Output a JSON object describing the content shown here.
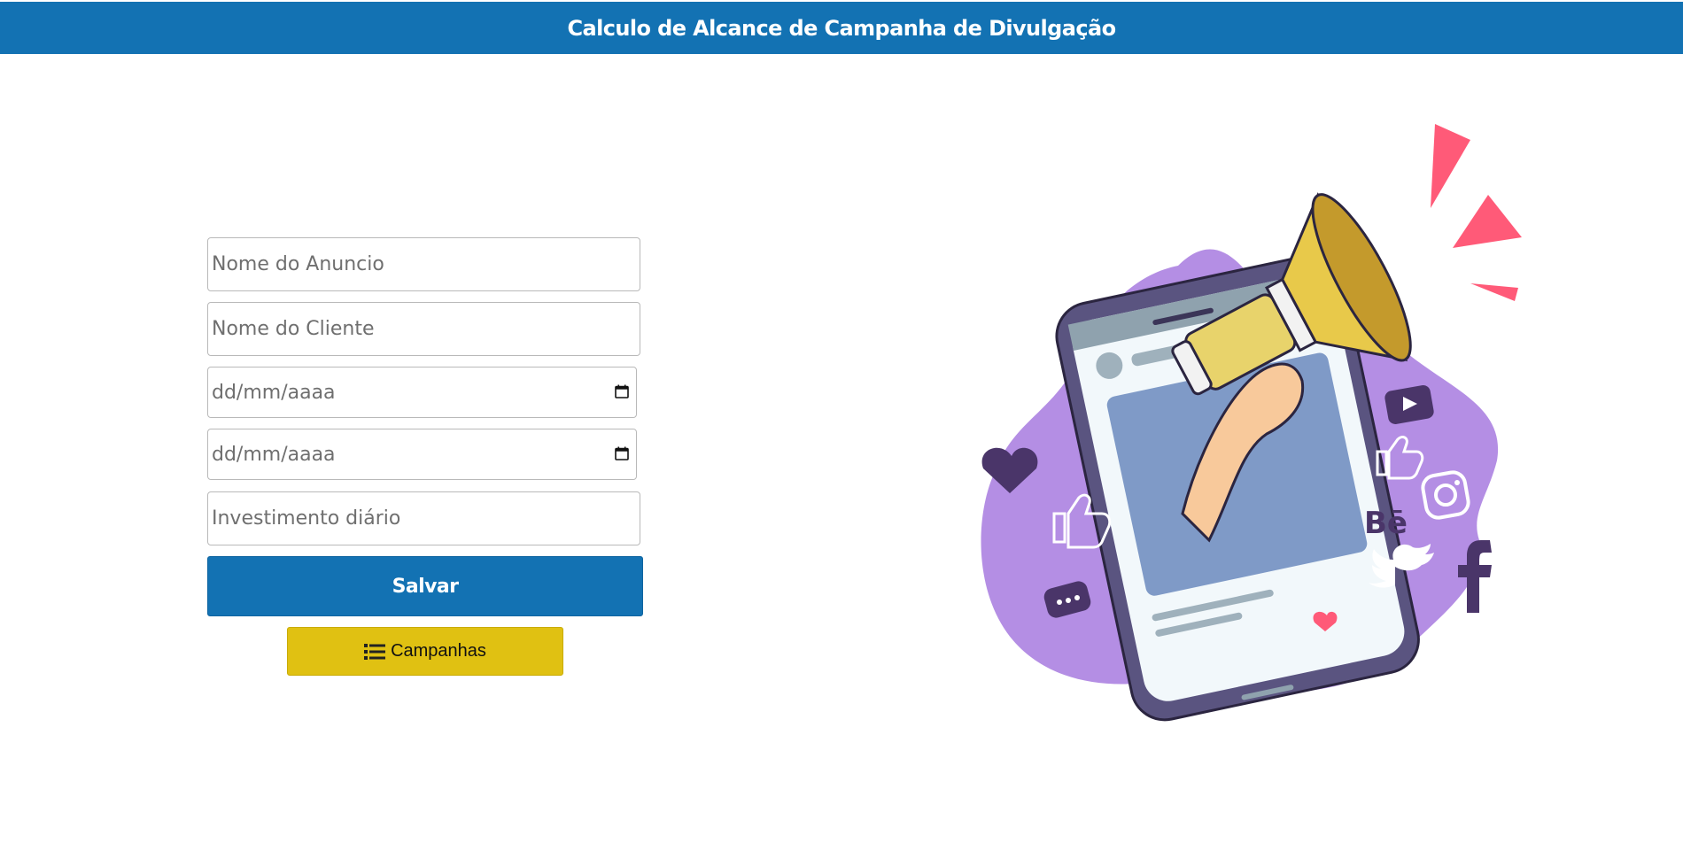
{
  "header": {
    "title": "Calculo de Alcance de Campanha de Divulgação"
  },
  "form": {
    "ad_name_placeholder": "Nome do Anuncio",
    "client_name_placeholder": "Nome do Cliente",
    "start_date_placeholder": "dd/mm/aaaa",
    "end_date_placeholder": "dd/mm/aaaa",
    "daily_investment_placeholder": "Investimento diário",
    "save_label": "Salvar",
    "campaigns_label": "Campanhas"
  },
  "colors": {
    "primary": "#1372b3",
    "campaigns_button": "#e0c112",
    "blob": "#b48ee4",
    "accent": "#ff5a78"
  },
  "icons": {
    "date_picker": "calendar-icon",
    "campaigns": "list-icon"
  },
  "illustration": {
    "behance_text": "Bē"
  }
}
